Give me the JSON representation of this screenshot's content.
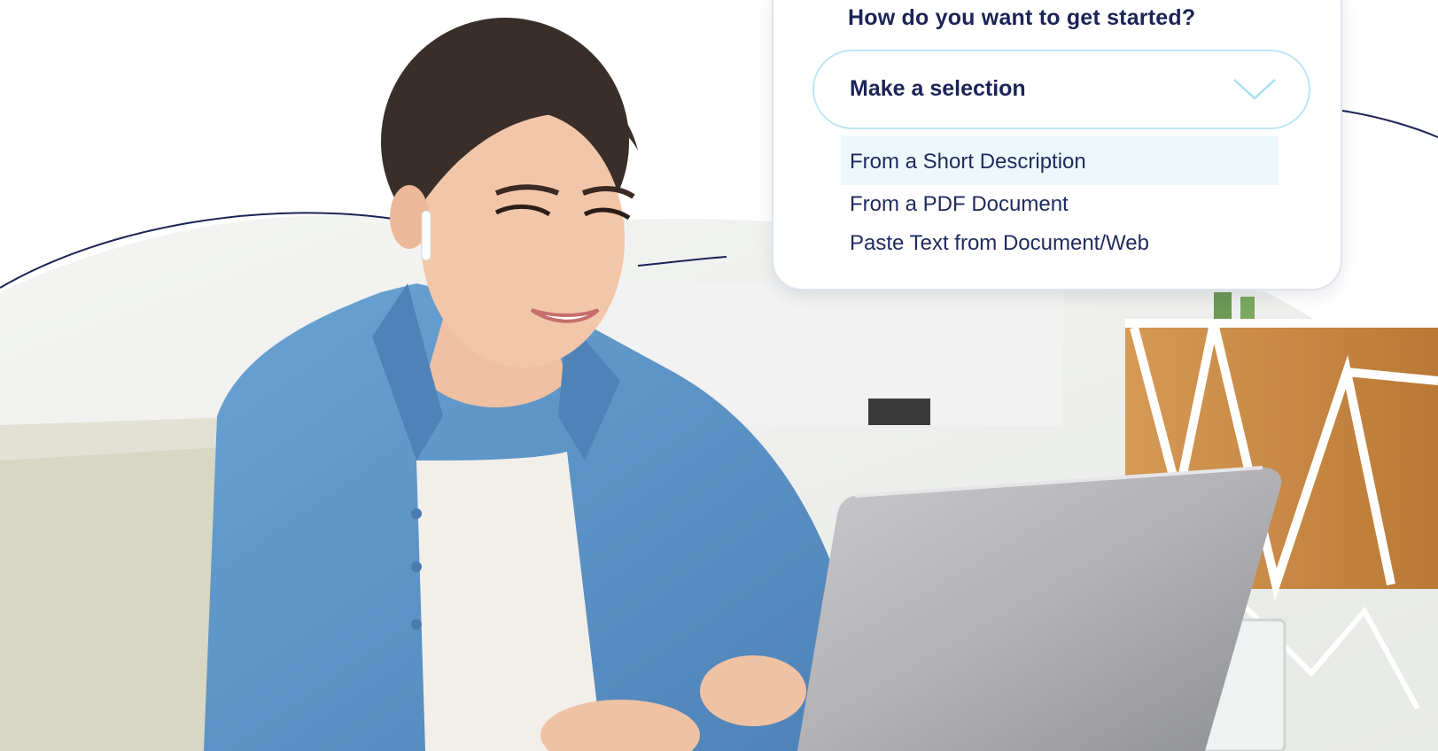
{
  "dropdown": {
    "question": "How do you want to get started?",
    "select_placeholder": "Make a selection",
    "options": [
      {
        "label": "From a Short Description",
        "highlighted": true
      },
      {
        "label": "From a PDF Document",
        "highlighted": false
      },
      {
        "label": "Paste Text from Document/Web",
        "highlighted": false
      }
    ]
  },
  "colors": {
    "text_primary": "#1b2456",
    "select_border": "#bfe7f3",
    "option_highlight": "#edf8fc",
    "shirt_blue": "#5e95c8",
    "wood": "#c88a46"
  },
  "illustration": {
    "subject": "woman-using-laptop",
    "icon": "chevron-down-icon"
  }
}
